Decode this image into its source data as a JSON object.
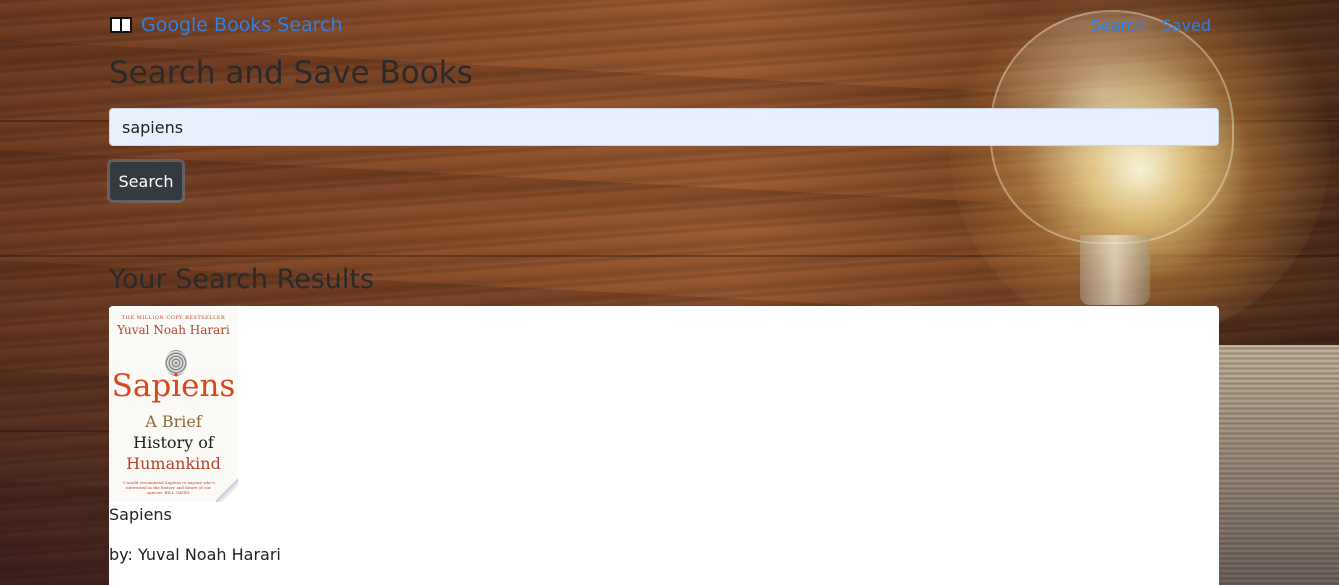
{
  "navbar": {
    "brand_icon": "open-book-icon",
    "brand_label": "Google Books Search",
    "links": [
      {
        "label": "Search"
      },
      {
        "label": "Saved"
      }
    ]
  },
  "page_title": "Search and Save Books",
  "search": {
    "value": "sapiens",
    "button_label": "Search"
  },
  "results": {
    "title": "Your Search Results",
    "items": [
      {
        "cover": {
          "tag": "THE MILLION COPY BESTSELLER",
          "author": "Yuval Noah Harari",
          "title": "Sapiens",
          "subtitle_line1": "A Brief",
          "subtitle_line2": "History of",
          "subtitle_line3": "Humankind",
          "quote": "'I would recommend Sapiens to anyone who's interested in the history and future of our species' BILL GATES"
        },
        "title": "Sapiens",
        "author_line": "by: Yuval Noah Harari"
      }
    ]
  },
  "colors": {
    "link": "#2f7fe6",
    "button_bg": "#343a40",
    "input_bg": "#e8f0fe"
  }
}
